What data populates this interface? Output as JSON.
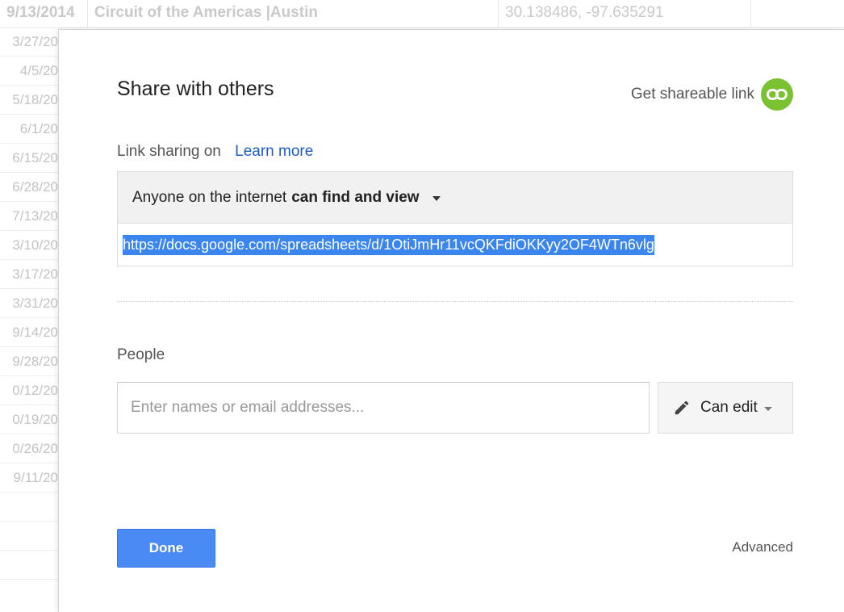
{
  "background_sheet": {
    "top_row": {
      "date": "9/13/2014",
      "name": "Circuit of the Americas |Austin",
      "coordinates": "30.138486, -97.635291"
    },
    "date_column": [
      "3/27/20",
      "4/5/20",
      "5/18/20",
      "6/1/20",
      "6/15/20",
      "6/28/20",
      "7/13/20",
      "3/10/20",
      "3/17/20",
      "3/31/20",
      "9/14/20",
      "9/28/20",
      "0/12/20",
      "0/19/20",
      "0/26/20",
      "9/11/20"
    ]
  },
  "dialog": {
    "title": "Share with others",
    "get_link_label": "Get shareable link",
    "link_sharing_label": "Link sharing on",
    "learn_more_label": "Learn more",
    "access_prefix": "Anyone on the internet",
    "access_level": "can find and view",
    "share_url": "https://docs.google.com/spreadsheets/d/1OtiJmHr11vcQKFdiOKKyy2OF4WTn6vlg",
    "people_label": "People",
    "people_placeholder": "Enter names or email addresses...",
    "permission_label": "Can edit",
    "done_label": "Done",
    "advanced_label": "Advanced"
  },
  "colors": {
    "link_icon_green": "#7ac231",
    "done_blue": "#4a8af4",
    "link_blue": "#1a5dc8",
    "selection_blue": "#3a86ee"
  },
  "icons": [
    "link-icon",
    "dropdown-caret-icon",
    "pencil-icon"
  ]
}
